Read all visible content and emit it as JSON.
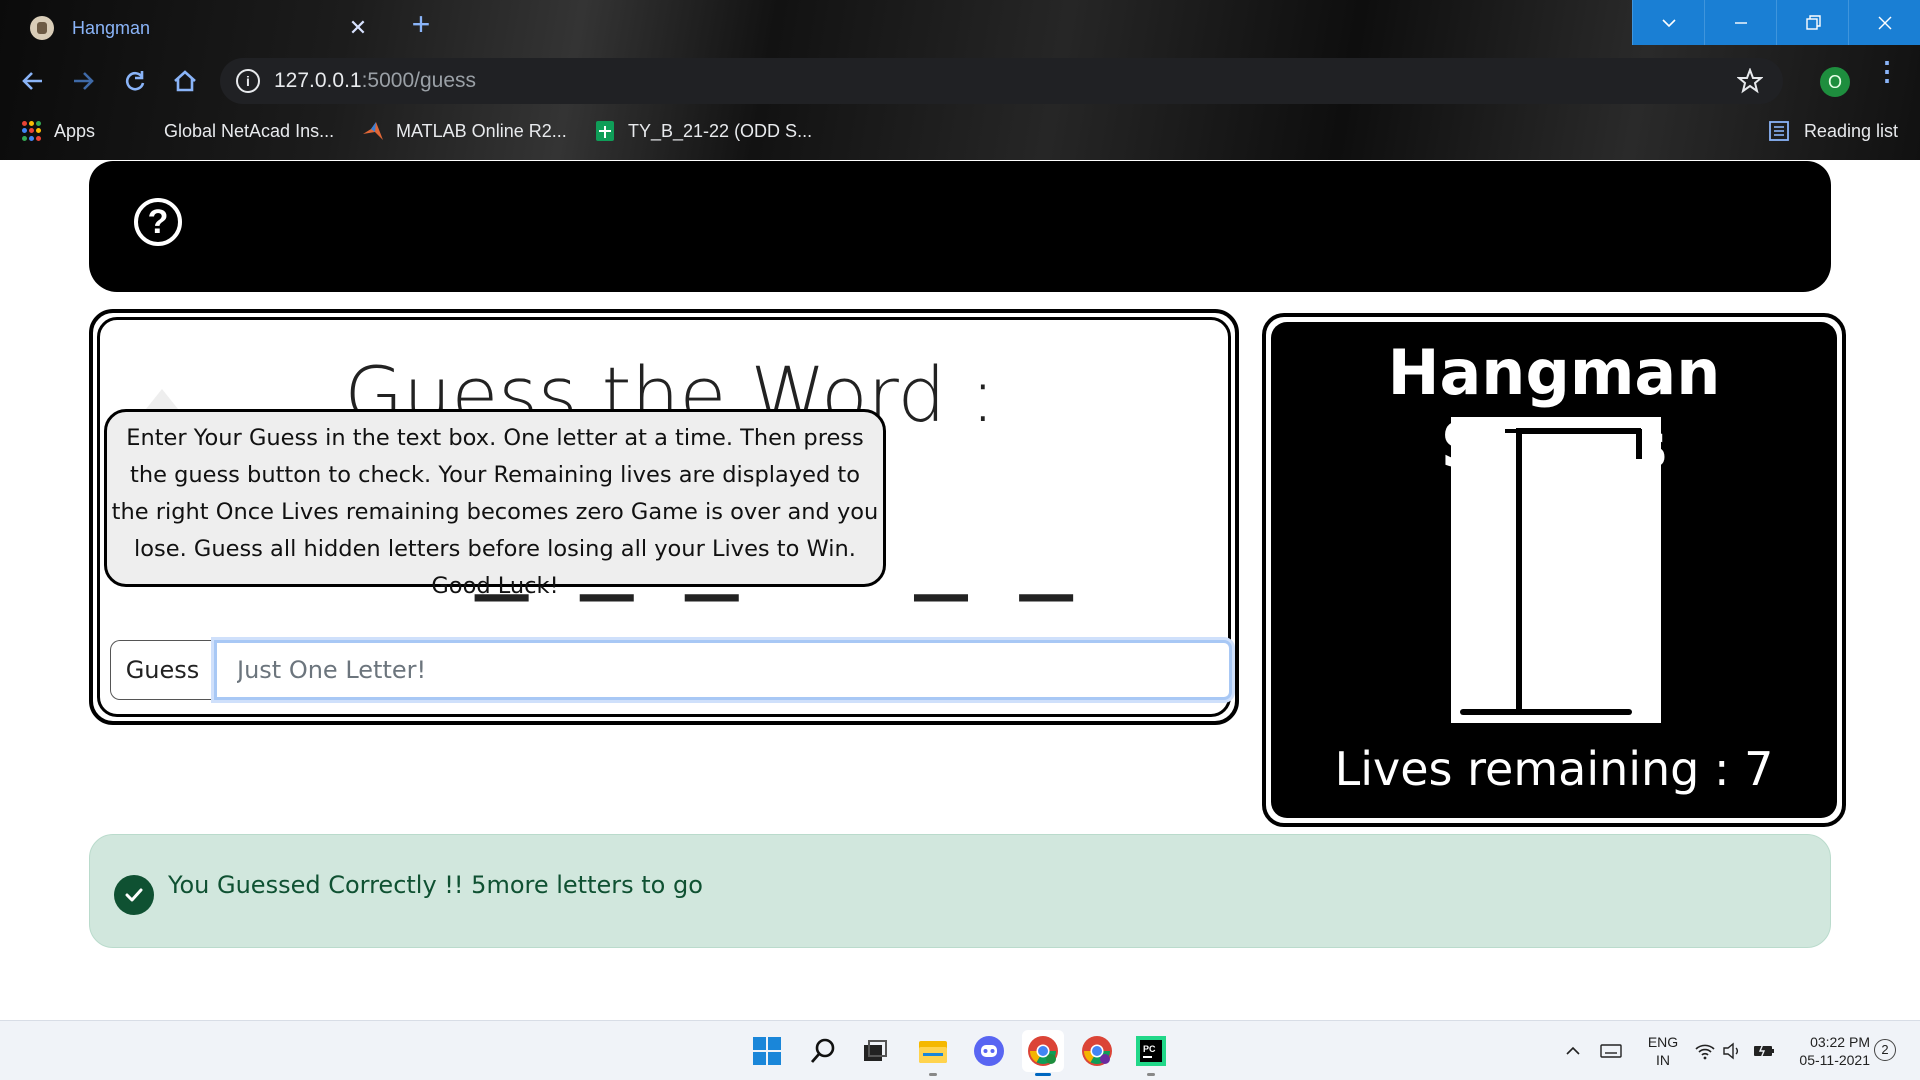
{
  "browser": {
    "tab_title": "Hangman",
    "url_host": "127.0.0.1",
    "url_path": ":5000/guess",
    "profile_initial": "O",
    "bookmarks": [
      {
        "label": "Apps",
        "icon": "apps-grid-icon"
      },
      {
        "label": "Global NetAcad Ins...",
        "icon": "netacad-icon"
      },
      {
        "label": "MATLAB Online R2...",
        "icon": "matlab-icon"
      },
      {
        "label": "TY_B_21-22 (ODD S...",
        "icon": "sheets-icon"
      }
    ],
    "reading_list": "Reading list"
  },
  "game": {
    "word_heading": "Guess the Word :",
    "word_display": "E L _ _ _ A _ _",
    "guess_button": "Guess",
    "guess_placeholder": "Just One Letter!",
    "help_icon": "?",
    "tooltip": "Enter Your Guess in the text box. One letter at a time. Then press the guess button to check. Your Remaining lives are displayed to the right Once Lives remaining becomes zero Game is over and you lose. Guess all hidden letters before losing all your Lives to Win. Good Luck!",
    "status_title": "Hangman Status",
    "lives_remaining": "Lives remaining : 7",
    "alert_message": "You Guessed Correctly !! 5more letters to go"
  },
  "taskbar": {
    "apps": [
      "start-icon",
      "search-icon",
      "task-view-icon",
      "file-explorer-icon",
      "discord-icon",
      "chrome-icon",
      "chrome-profile-icon",
      "pycharm-icon"
    ],
    "lang_line1": "ENG",
    "lang_line2": "IN",
    "time": "03:22 PM",
    "date": "05-11-2021",
    "notification_count": "2"
  },
  "colors": {
    "alert_bg": "#d1e7dd",
    "alert_text": "#0f5132",
    "accent_blue": "#8ab4f8",
    "window_buttons": "#1a7fd4"
  }
}
